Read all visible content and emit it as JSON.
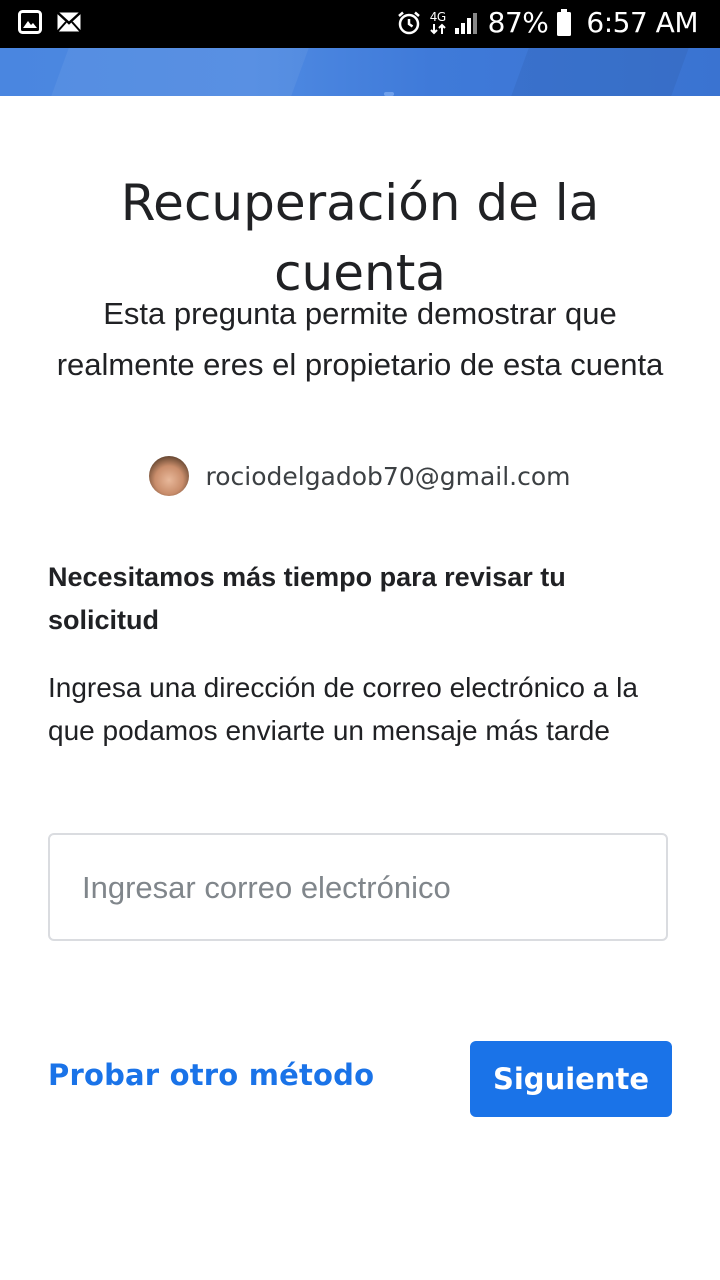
{
  "status_bar": {
    "icons_left": [
      "image-icon",
      "mail-icon"
    ],
    "icons_right": [
      "alarm-icon",
      "4g-icon",
      "signal-icon",
      "battery-icon"
    ],
    "network": "4G",
    "battery": "87%",
    "time": "6:57 AM"
  },
  "header": {
    "title": "Recuperación de la cuenta",
    "subtitle": "Esta pregunta permite demostrar que realmente eres el propietario de esta cuenta"
  },
  "account": {
    "email": "rociodelgadob70@gmail.com"
  },
  "body": {
    "heading": "Necesitamos más tiempo para revisar tu solicitud",
    "description": "Ingresa una dirección de correo electrónico a la que podamos enviarte un mensaje más tarde"
  },
  "email_input": {
    "value": "",
    "placeholder": "Ingresar correo electrónico"
  },
  "actions": {
    "try_another": "Probar otro método",
    "next": "Siguiente"
  },
  "colors": {
    "accent": "#1a73e8",
    "banner": "#4a86e0"
  }
}
